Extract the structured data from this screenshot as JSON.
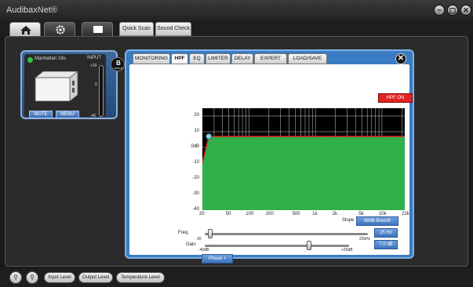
{
  "app": {
    "title": "AudibaxNet®"
  },
  "window_controls": {
    "minimize": "−",
    "maximize": "▢",
    "close": "✕"
  },
  "top_tabs": {
    "home_icon": "home-icon",
    "settings_icon": "gear-icon",
    "monitor_icon": "screen-icon",
    "quick_scan": "Quick Scan",
    "sound_check": "Sound Check"
  },
  "device": {
    "name": "Manhattan 18s",
    "input_label": "INPUT",
    "scale": [
      "+20",
      "0",
      "-40"
    ],
    "mute_label": "MUTE",
    "menu_label": "MENU",
    "group_letter": "B",
    "group_label": "GROUP"
  },
  "panel": {
    "tabs": [
      "MONITORING",
      "HPF",
      "EQ",
      "LIMITER",
      "DELAY",
      "EXPERT",
      "LOAD/SAVE"
    ],
    "active_tab": "HPF",
    "close": "✕",
    "hpf_button": "HPF ON",
    "slope_label": "Slope",
    "slope_value": "48dB-Bworth",
    "freq_label": "Freq.",
    "freq_min": "20",
    "freq_max": "22kHz",
    "freq_value": "25 Hz",
    "gain_label": "Gain",
    "gain_min": "-40dB",
    "gain_max": "+25dB",
    "gain_value": "7.0 dB",
    "phase_button": "Phase +"
  },
  "chart_data": {
    "type": "line",
    "x_scale": "log",
    "xlim": [
      20,
      22000
    ],
    "ylim": [
      -40,
      25
    ],
    "x_ticks": [
      "20",
      "50",
      "100",
      "200",
      "500",
      "1k",
      "2k",
      "5k",
      "10k",
      "22k"
    ],
    "y_ticks": [
      "20",
      "10",
      "0dB",
      "-10",
      "-20",
      "-30",
      "-40"
    ],
    "series": [
      {
        "x": [
          20,
          25,
          22000
        ],
        "y": [
          -10,
          7,
          7
        ]
      }
    ],
    "fill_color": "#2fb04a",
    "line_color": "#e02424"
  },
  "bottom": {
    "zoom_in": "zoom-in-icon",
    "zoom_out": "zoom-out-icon",
    "input_level": "Input Level",
    "output_level": "Output Level",
    "temperature_level": "Temperature Level"
  }
}
